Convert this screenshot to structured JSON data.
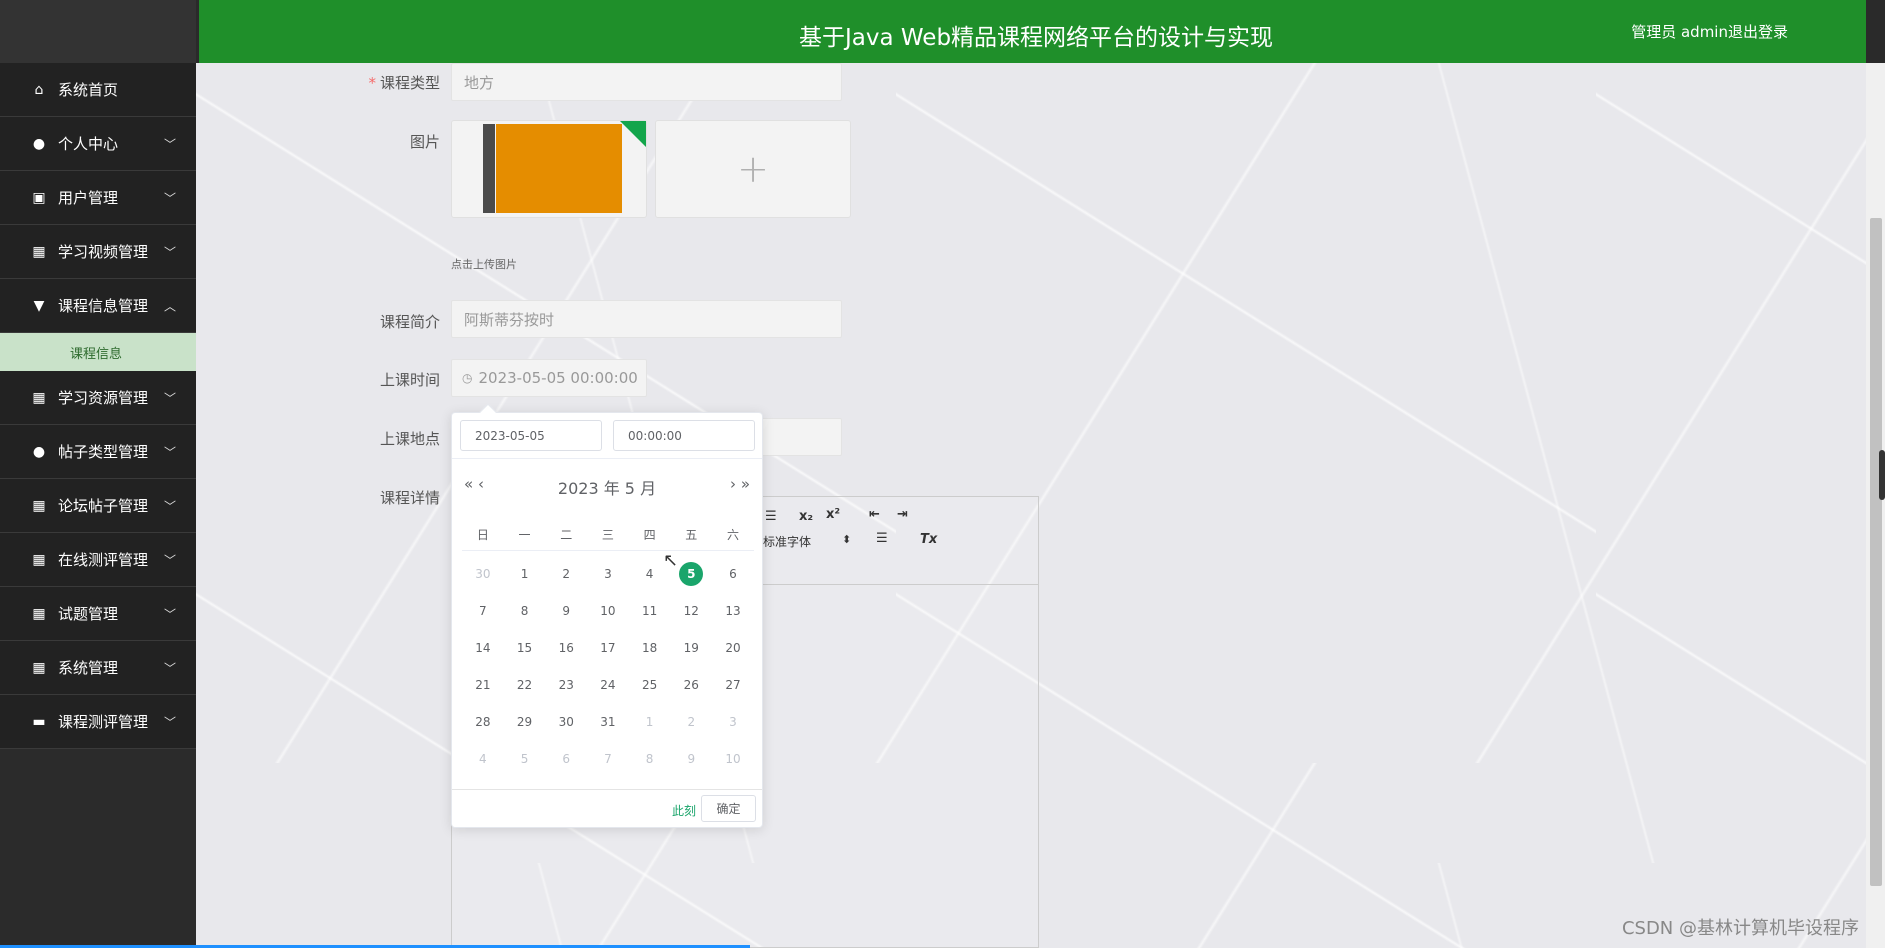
{
  "header": {
    "title": "基于Java Web精品课程网络平台的设计与实现",
    "user": "管理员 admin",
    "logout": "退出登录"
  },
  "sidebar": {
    "items": [
      {
        "label": "系统首页",
        "icon": "home-icon",
        "glyph": "⌂",
        "chevron": ""
      },
      {
        "label": "个人中心",
        "icon": "person-icon",
        "glyph": "●",
        "chevron": "﹀"
      },
      {
        "label": "用户管理",
        "icon": "clipboard-icon",
        "glyph": "▣",
        "chevron": "﹀"
      },
      {
        "label": "学习视频管理",
        "icon": "grid-icon",
        "glyph": "▦",
        "chevron": "﹀"
      },
      {
        "label": "课程信息管理",
        "icon": "pin-icon",
        "glyph": "▼",
        "chevron": "︿"
      },
      {
        "label": "学习资源管理",
        "icon": "grid-icon",
        "glyph": "▦",
        "chevron": "﹀"
      },
      {
        "label": "帖子类型管理",
        "icon": "person-icon",
        "glyph": "●",
        "chevron": "﹀"
      },
      {
        "label": "论坛帖子管理",
        "icon": "grid-icon",
        "glyph": "▦",
        "chevron": "﹀"
      },
      {
        "label": "在线测评管理",
        "icon": "grid-icon",
        "glyph": "▦",
        "chevron": "﹀"
      },
      {
        "label": "试题管理",
        "icon": "grid-icon",
        "glyph": "▦",
        "chevron": "﹀"
      },
      {
        "label": "系统管理",
        "icon": "grid-icon",
        "glyph": "▦",
        "chevron": "﹀"
      },
      {
        "label": "课程测评管理",
        "icon": "briefcase-icon",
        "glyph": "▬",
        "chevron": "﹀"
      }
    ],
    "submenu": {
      "label": "课程信息"
    }
  },
  "form": {
    "course_type": {
      "label": "课程类型",
      "required": "*",
      "value": "地方"
    },
    "image": {
      "label": "图片",
      "hint": "点击上传图片",
      "plus": "+"
    },
    "intro": {
      "label": "课程简介",
      "value": "阿斯蒂芬按时"
    },
    "time": {
      "label": "上课时间",
      "value": "2023-05-05 00:00:00",
      "icon": "clock-icon"
    },
    "location": {
      "label": "上课地点"
    },
    "detail": {
      "label": "课程详情"
    }
  },
  "editor_toolbar": {
    "list": "☰",
    "subscript": "x₂",
    "superscript": "x²",
    "outdent": "⇤",
    "indent": "⇥",
    "font": "标准字体",
    "font_arrow": "⬍",
    "align": "☰",
    "clear_format": "Tx"
  },
  "date_picker": {
    "date_input": "2023-05-05",
    "time_input": "00:00:00",
    "title": "2023 年  5 月",
    "prev_year": "«",
    "prev_month": "‹",
    "next_month": "›",
    "next_year": "»",
    "weekdays": [
      "日",
      "一",
      "二",
      "三",
      "四",
      "五",
      "六"
    ],
    "weeks": [
      [
        {
          "d": "30",
          "m": 1
        },
        {
          "d": "1"
        },
        {
          "d": "2"
        },
        {
          "d": "3"
        },
        {
          "d": "4"
        },
        {
          "d": "5",
          "s": 1
        },
        {
          "d": "6"
        }
      ],
      [
        {
          "d": "7"
        },
        {
          "d": "8"
        },
        {
          "d": "9"
        },
        {
          "d": "10"
        },
        {
          "d": "11"
        },
        {
          "d": "12"
        },
        {
          "d": "13"
        }
      ],
      [
        {
          "d": "14"
        },
        {
          "d": "15"
        },
        {
          "d": "16"
        },
        {
          "d": "17"
        },
        {
          "d": "18"
        },
        {
          "d": "19"
        },
        {
          "d": "20"
        }
      ],
      [
        {
          "d": "21"
        },
        {
          "d": "22"
        },
        {
          "d": "23"
        },
        {
          "d": "24"
        },
        {
          "d": "25"
        },
        {
          "d": "26"
        },
        {
          "d": "27"
        }
      ],
      [
        {
          "d": "28"
        },
        {
          "d": "29"
        },
        {
          "d": "30"
        },
        {
          "d": "31"
        },
        {
          "d": "1",
          "m": 1
        },
        {
          "d": "2",
          "m": 1
        },
        {
          "d": "3",
          "m": 1
        }
      ],
      [
        {
          "d": "4",
          "m": 1
        },
        {
          "d": "5",
          "m": 1
        },
        {
          "d": "6",
          "m": 1
        },
        {
          "d": "7",
          "m": 1
        },
        {
          "d": "8",
          "m": 1
        },
        {
          "d": "9",
          "m": 1
        },
        {
          "d": "10",
          "m": 1
        }
      ]
    ],
    "now": "此刻",
    "confirm": "确定"
  },
  "watermark": "CSDN @基林计算机毕设程序",
  "colors": {
    "header": "#1f8f2a",
    "accent": "#1aa56b",
    "submenu_bg": "#c9e2c9"
  }
}
